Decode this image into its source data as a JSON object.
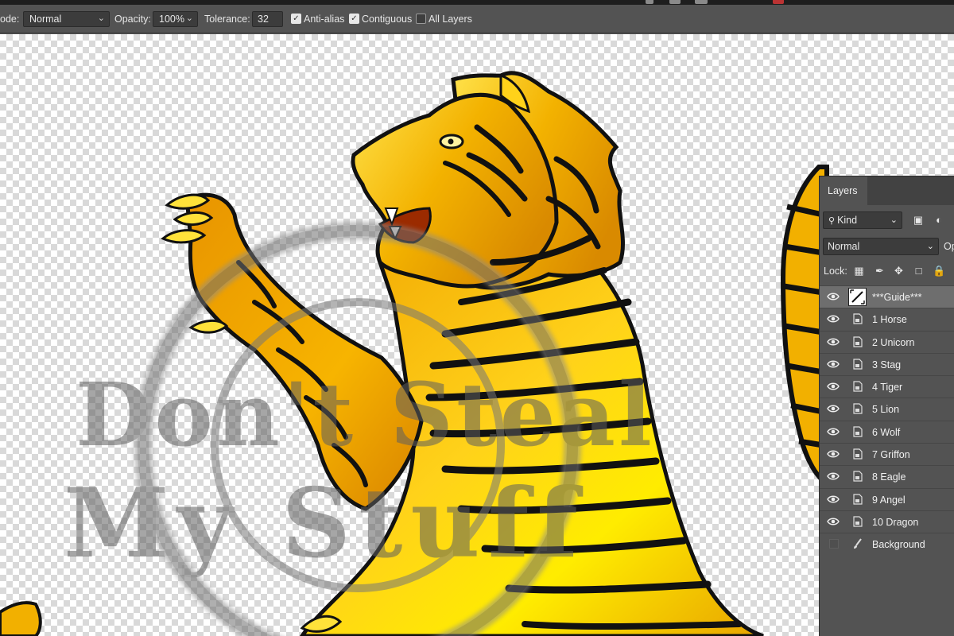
{
  "options_bar": {
    "mode_label": "ode:",
    "mode_value": "Normal",
    "opacity_label": "Opacity:",
    "opacity_value": "100%",
    "tolerance_label": "Tolerance:",
    "tolerance_value": "32",
    "anti_alias": {
      "label": "Anti-alias",
      "checked": true
    },
    "contiguous": {
      "label": "Contiguous",
      "checked": true
    },
    "all_layers": {
      "label": "All Layers",
      "checked": false
    }
  },
  "canvas": {
    "watermark_line1": "Don't Steal",
    "watermark_line2": "My Stuff"
  },
  "layers_panel": {
    "tab_label": "Layers",
    "filter_label": "Kind",
    "blend_mode": "Normal",
    "opacity_label_partial": "Op",
    "lock_label": "Lock:",
    "layers": [
      {
        "name": "***Guide***",
        "visible": true,
        "selected": true,
        "icon": "guide-thumbnail-icon"
      },
      {
        "name": "1 Horse",
        "visible": true,
        "selected": false,
        "icon": "smart-object-icon"
      },
      {
        "name": "2 Unicorn",
        "visible": true,
        "selected": false,
        "icon": "smart-object-icon"
      },
      {
        "name": "3 Stag",
        "visible": true,
        "selected": false,
        "icon": "smart-object-icon"
      },
      {
        "name": "4 Tiger",
        "visible": true,
        "selected": false,
        "icon": "smart-object-icon"
      },
      {
        "name": "5 Lion",
        "visible": true,
        "selected": false,
        "icon": "smart-object-icon"
      },
      {
        "name": "6 Wolf",
        "visible": true,
        "selected": false,
        "icon": "smart-object-icon"
      },
      {
        "name": "7 Griffon",
        "visible": true,
        "selected": false,
        "icon": "smart-object-icon"
      },
      {
        "name": "8 Eagle",
        "visible": true,
        "selected": false,
        "icon": "smart-object-icon"
      },
      {
        "name": "9 Angel",
        "visible": true,
        "selected": false,
        "icon": "smart-object-icon"
      },
      {
        "name": "10 Dragon",
        "visible": true,
        "selected": false,
        "icon": "smart-object-icon"
      },
      {
        "name": "Background",
        "visible": false,
        "selected": false,
        "icon": "brush-icon"
      }
    ]
  },
  "colors": {
    "panel_bg": "#535353",
    "tiger_gold": "#f2b400",
    "tiger_yellow": "#ffe600",
    "stroke": "#111111"
  }
}
